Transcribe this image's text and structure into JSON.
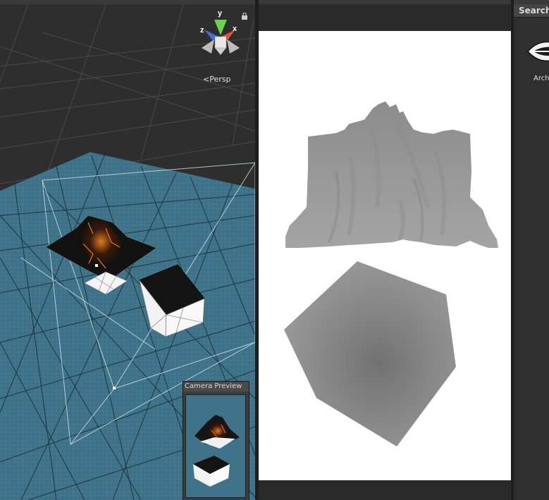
{
  "scene_view": {
    "gizmo_axes": {
      "y": "y",
      "x": "x",
      "z": "z"
    },
    "projection_label": "Persp"
  },
  "camera_preview": {
    "title": "Camera Preview"
  },
  "right_panel": {
    "search_label": "Search",
    "asset_label": "Arch"
  },
  "colors": {
    "editor_bg": "#282828",
    "scene_bg": "#2e2e2e",
    "ground": "#3f7389",
    "gizmo_y": "#6cd44a",
    "gizmo_x": "#e0533a",
    "gizmo_z": "#3f6fd8",
    "game_bg": "#ffffff"
  },
  "icons": [
    "lock-icon",
    "axis-gizmo",
    "asset-thumbnail-icon"
  ]
}
